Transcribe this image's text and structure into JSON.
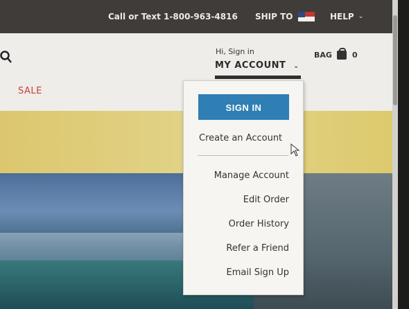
{
  "topbar": {
    "phone": "Call or Text 1-800-963-4816",
    "ship_to": "SHIP TO",
    "help": "HELP",
    "help_chevron": "⌄"
  },
  "header": {
    "search_icon": "search-icon",
    "greeting": "Hi, Sign in",
    "my_account": "MY ACCOUNT",
    "my_account_chevron": "⌄",
    "bag_label": "BAG",
    "bag_count": "0"
  },
  "nav": {
    "sale": "SALE"
  },
  "dropdown": {
    "sign_in": "SIGN IN",
    "create_account": "Create an Account",
    "items": [
      "Manage Account",
      "Edit Order",
      "Order History",
      "Refer a Friend",
      "Email Sign Up"
    ]
  },
  "colors": {
    "topbar": "#3f3c39",
    "sign_in_button": "#2f7eb4",
    "sale": "#c83d35"
  }
}
